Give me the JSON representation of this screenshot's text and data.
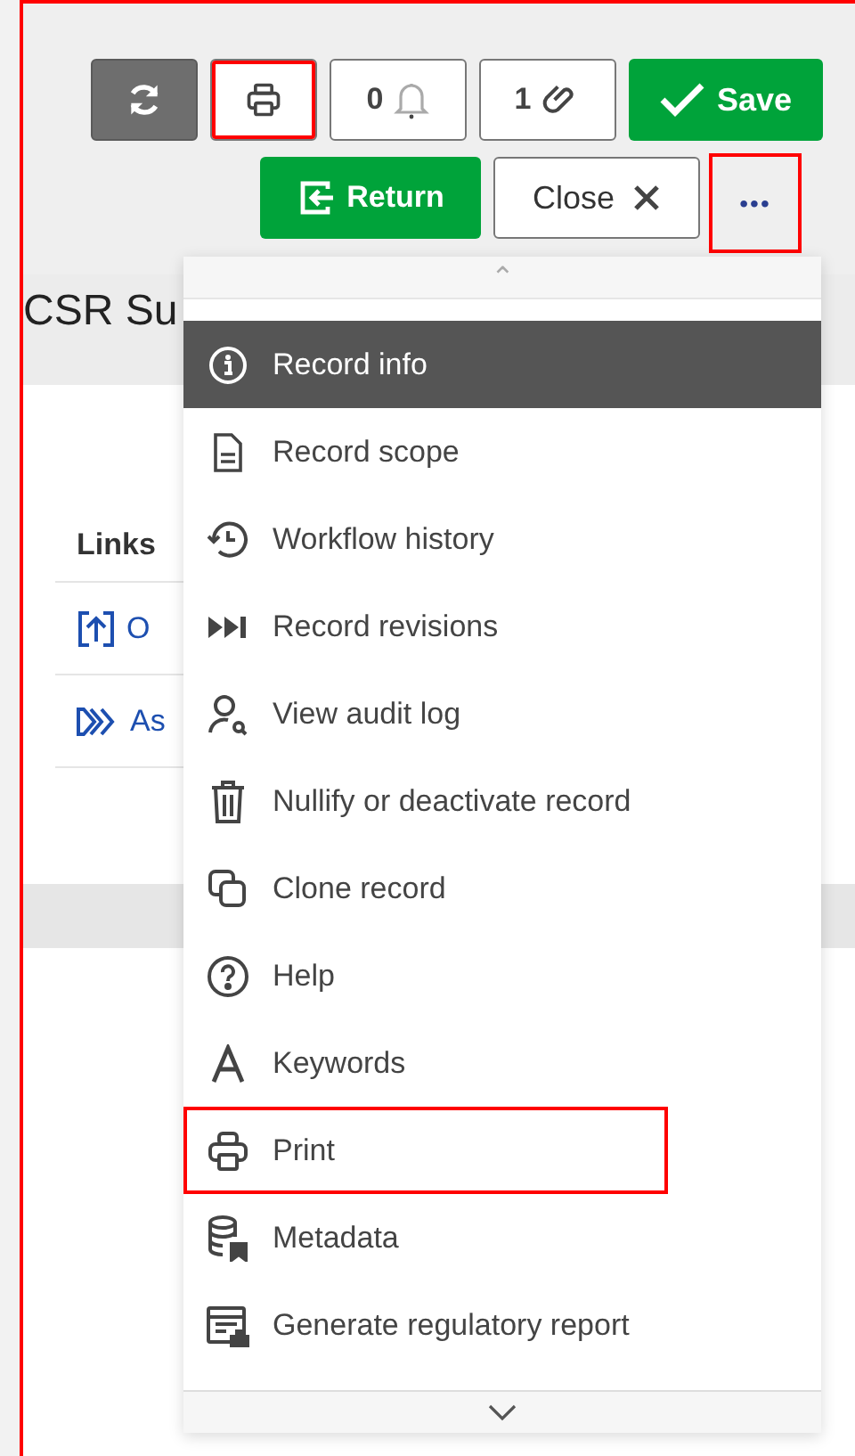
{
  "toolbar": {
    "row_1": [
      {
        "kind": "refresh",
        "highlighted": false
      },
      {
        "kind": "print",
        "highlighted": true
      },
      {
        "kind": "count",
        "label": "0",
        "highlighted": false
      },
      {
        "kind": "count",
        "label": "1",
        "highlighted": false
      },
      {
        "kind": "primary",
        "label": "Save",
        "highlighted": false
      }
    ],
    "row_2": [
      {
        "kind": "primary",
        "label": "Return",
        "highlighted": false
      },
      {
        "kind": "default",
        "label": "Close",
        "highlighted": false
      },
      {
        "kind": "more",
        "label": "•••",
        "highlighted": true
      }
    ]
  },
  "page": {
    "title": "CSR Su",
    "links_heading": "Links",
    "links": [
      "O",
      "As"
    ]
  },
  "menu": {
    "scroll_up": "⌃",
    "items": [
      {
        "label": "Record info",
        "selected": true,
        "highlighted": false
      },
      {
        "label": "Record scope",
        "selected": false,
        "highlighted": false
      },
      {
        "label": "Workflow history",
        "selected": false,
        "highlighted": false
      },
      {
        "label": "Record revisions",
        "selected": false,
        "highlighted": false
      },
      {
        "label": "View audit log",
        "selected": false,
        "highlighted": false
      },
      {
        "label": "Nullify or deactivate record",
        "selected": false,
        "highlighted": false
      },
      {
        "label": "Clone record",
        "selected": false,
        "highlighted": false
      },
      {
        "label": "Help",
        "selected": false,
        "highlighted": false
      },
      {
        "label": "Keywords",
        "selected": false,
        "highlighted": false
      },
      {
        "label": "Print",
        "selected": false,
        "highlighted": true
      },
      {
        "label": "Metadata",
        "selected": false,
        "highlighted": false
      },
      {
        "label": "Generate regulatory report",
        "selected": false,
        "highlighted": false
      }
    ]
  }
}
